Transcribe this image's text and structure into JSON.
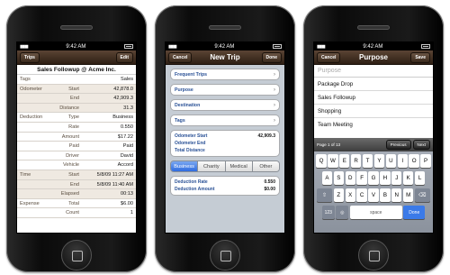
{
  "phones": [
    {
      "status_time": "9:42 AM",
      "nav": {
        "left": "Trips",
        "title": "",
        "right": "Edit"
      },
      "header": "Sales Followup @ Acme Inc.",
      "rows": [
        {
          "a": "Tags",
          "b": "",
          "c": "Sales",
          "alt": false
        },
        {
          "a": "Odometer",
          "b": "Start",
          "c": "42,878.0",
          "alt": true
        },
        {
          "a": "",
          "b": "End",
          "c": "42,909.3",
          "alt": true
        },
        {
          "a": "",
          "b": "Distance",
          "c": "31.3",
          "alt": true
        },
        {
          "a": "Deduction",
          "b": "Type",
          "c": "Business",
          "alt": false
        },
        {
          "a": "",
          "b": "Rate",
          "c": "0.550",
          "alt": false
        },
        {
          "a": "",
          "b": "Amount",
          "c": "$17.22",
          "alt": false
        },
        {
          "a": "",
          "b": "Paid",
          "c": "Paid",
          "alt": false
        },
        {
          "a": "",
          "b": "Driver",
          "c": "David",
          "alt": false
        },
        {
          "a": "",
          "b": "Vehicle",
          "c": "Accord",
          "alt": false
        },
        {
          "a": "Time",
          "b": "Start",
          "c": "5/8/09 11:27 AM",
          "alt": true
        },
        {
          "a": "",
          "b": "End",
          "c": "5/8/09 11:40 AM",
          "alt": true
        },
        {
          "a": "",
          "b": "Elapsed",
          "c": "00:13",
          "alt": true
        },
        {
          "a": "Expense",
          "b": "Total",
          "c": "$6.00",
          "alt": false
        },
        {
          "a": "",
          "b": "Count",
          "c": "1",
          "alt": false
        }
      ]
    },
    {
      "status_time": "9:42 AM",
      "nav": {
        "left": "Cancel",
        "title": "New Trip",
        "right": "Done"
      },
      "cells": [
        "Frequent Trips",
        "Purpose",
        "Destination",
        "Tags"
      ],
      "odometer": [
        {
          "label": "Odometer Start",
          "value": "42,909.3"
        },
        {
          "label": "Odometer End",
          "value": ""
        },
        {
          "label": "Total Distance",
          "value": ""
        }
      ],
      "segments": [
        "Business",
        "Charity",
        "Medical",
        "Other"
      ],
      "selected_segment": "Business",
      "deduction": [
        {
          "label": "Deduction Rate",
          "value": "0.550"
        },
        {
          "label": "Deduction Amount",
          "value": "$0.00"
        }
      ]
    },
    {
      "status_time": "9:42 AM",
      "nav": {
        "left": "Cancel",
        "title": "Purpose",
        "right": "Save"
      },
      "purpose_placeholder": "Purpose",
      "options": [
        "Package Drop",
        "Sales Followup",
        "Shopping",
        "Team Meeting"
      ],
      "accessory": {
        "page": "Page 1 of 13",
        "prev": "Previous",
        "next": "Next"
      },
      "keyboard": {
        "row1": [
          "Q",
          "W",
          "E",
          "R",
          "T",
          "Y",
          "U",
          "I",
          "O",
          "P"
        ],
        "row2": [
          "A",
          "S",
          "D",
          "F",
          "G",
          "H",
          "J",
          "K",
          "L"
        ],
        "row3": [
          "Z",
          "X",
          "C",
          "V",
          "B",
          "N",
          "M"
        ],
        "num": "123",
        "space": "space",
        "done": "Done"
      }
    }
  ]
}
